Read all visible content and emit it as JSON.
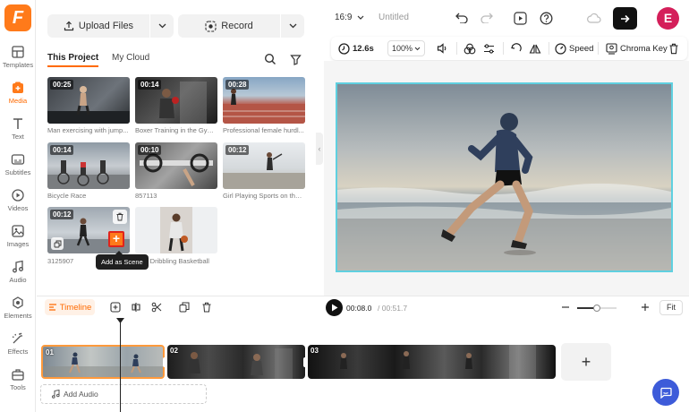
{
  "app": {
    "logo_letter": "F",
    "brand_color": "#ff7a1a"
  },
  "rail": {
    "items": [
      {
        "label": "Templates",
        "icon": "templates-icon"
      },
      {
        "label": "Media",
        "icon": "media-icon"
      },
      {
        "label": "Text",
        "icon": "text-icon"
      },
      {
        "label": "Subtitles",
        "icon": "subtitles-icon"
      },
      {
        "label": "Videos",
        "icon": "videos-icon"
      },
      {
        "label": "Images",
        "icon": "images-icon"
      },
      {
        "label": "Audio",
        "icon": "audio-icon"
      },
      {
        "label": "Elements",
        "icon": "elements-icon"
      },
      {
        "label": "Effects",
        "icon": "effects-icon"
      },
      {
        "label": "Tools",
        "icon": "tools-icon"
      }
    ]
  },
  "media": {
    "upload_label": "Upload Files",
    "record_label": "Record",
    "tabs": [
      "This Project",
      "My Cloud"
    ],
    "items": [
      {
        "duration": "00:25",
        "label": "Man exercising with jump..."
      },
      {
        "duration": "00:14",
        "label": "Boxer Training in the Gym..."
      },
      {
        "duration": "00:28",
        "label": "Professional female hurdl..."
      },
      {
        "duration": "00:14",
        "label": "Bicycle Race"
      },
      {
        "duration": "00:10",
        "label": "857113"
      },
      {
        "duration": "00:12",
        "label": "Girl Playing Sports on the ..."
      },
      {
        "duration": "00:12",
        "label": "3125907"
      },
      {
        "duration": "",
        "label": "...an Dribbling Basketball"
      }
    ],
    "tooltip": "Add as Scene",
    "add_symbol": "+"
  },
  "topbar": {
    "ratio": "16:9",
    "title": "Untitled",
    "avatar_letter": "E",
    "avatar_color": "#d41f5a"
  },
  "toolbar": {
    "duration": "12.6s",
    "zoom": "100%",
    "speed_label": "Speed",
    "chroma_label": "Chroma Key"
  },
  "timeline": {
    "label": "Timeline",
    "current_time": "00:08.0",
    "total_time": "/ 00:51.7",
    "zoom_level": 0.5,
    "fit_label": "Fit",
    "clips": [
      "01",
      "02",
      "03"
    ],
    "add_clip_symbol": "+",
    "add_audio_label": "Add Audio"
  }
}
